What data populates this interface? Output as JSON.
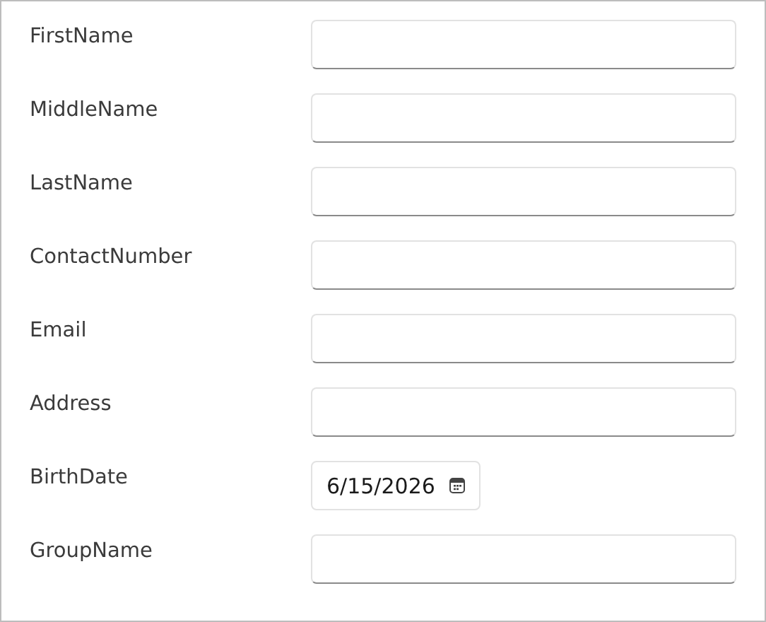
{
  "fields": [
    {
      "label": "FirstName",
      "kind": "text"
    },
    {
      "label": "MiddleName",
      "kind": "text"
    },
    {
      "label": "LastName",
      "kind": "text"
    },
    {
      "label": "ContactNumber",
      "kind": "text"
    },
    {
      "label": "Email",
      "kind": "text"
    },
    {
      "label": "Address",
      "kind": "text"
    },
    {
      "label": "BirthDate",
      "kind": "date",
      "value": "6/15/2026"
    },
    {
      "label": "GroupName",
      "kind": "text"
    }
  ]
}
